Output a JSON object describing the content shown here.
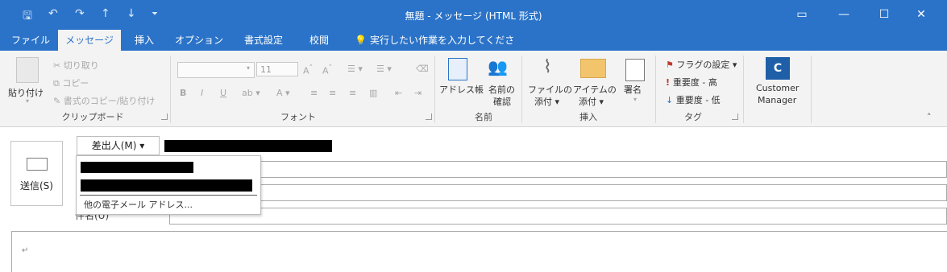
{
  "window": {
    "title": "無題 - メッセージ (HTML 形式)",
    "qat_save": "🖫",
    "qat_undo": "↶",
    "qat_redo": "↷",
    "qat_up": "↑",
    "qat_down": "↓",
    "qat_more": "⏷",
    "btn_display": "▭",
    "btn_min": "—",
    "btn_max": "☐",
    "btn_close": "✕"
  },
  "tabs": [
    "ファイル",
    "メッセージ",
    "挿入",
    "オプション",
    "書式設定",
    "校閲"
  ],
  "tell_me": "実行したい作業を入力してください",
  "ribbon": {
    "clipboard": {
      "paste": "貼り付け",
      "cut": "切り取り",
      "copy": "コピー",
      "format_painter": "書式のコピー/貼り付け",
      "label": "クリップボード"
    },
    "font": {
      "font_size": "11",
      "label": "フォント"
    },
    "names": {
      "address_book": "アドレス帳",
      "check_names_1": "名前の",
      "check_names_2": "確認",
      "label": "名前"
    },
    "include": {
      "attach_file_1": "ファイルの",
      "attach_file_2": "添付 ▾",
      "attach_item_1": "アイテムの",
      "attach_item_2": "添付 ▾",
      "signature": "署名",
      "label": "挿入"
    },
    "tags": {
      "follow_up": "フラグの設定 ▾",
      "high_importance": "重要度 - 高",
      "low_importance": "重要度 - 低",
      "label": "タグ"
    },
    "addin": {
      "customer_manager_1": "Customer",
      "customer_manager_2": "Manager"
    }
  },
  "compose": {
    "send_label": "送信(S)",
    "from_label": "差出人(M) ▾",
    "subject_label": "件名(U)",
    "from_menu_other": "他の電子メール アドレス...",
    "body_mark": "↵"
  },
  "colors": {
    "accent": "#2b73c8"
  }
}
